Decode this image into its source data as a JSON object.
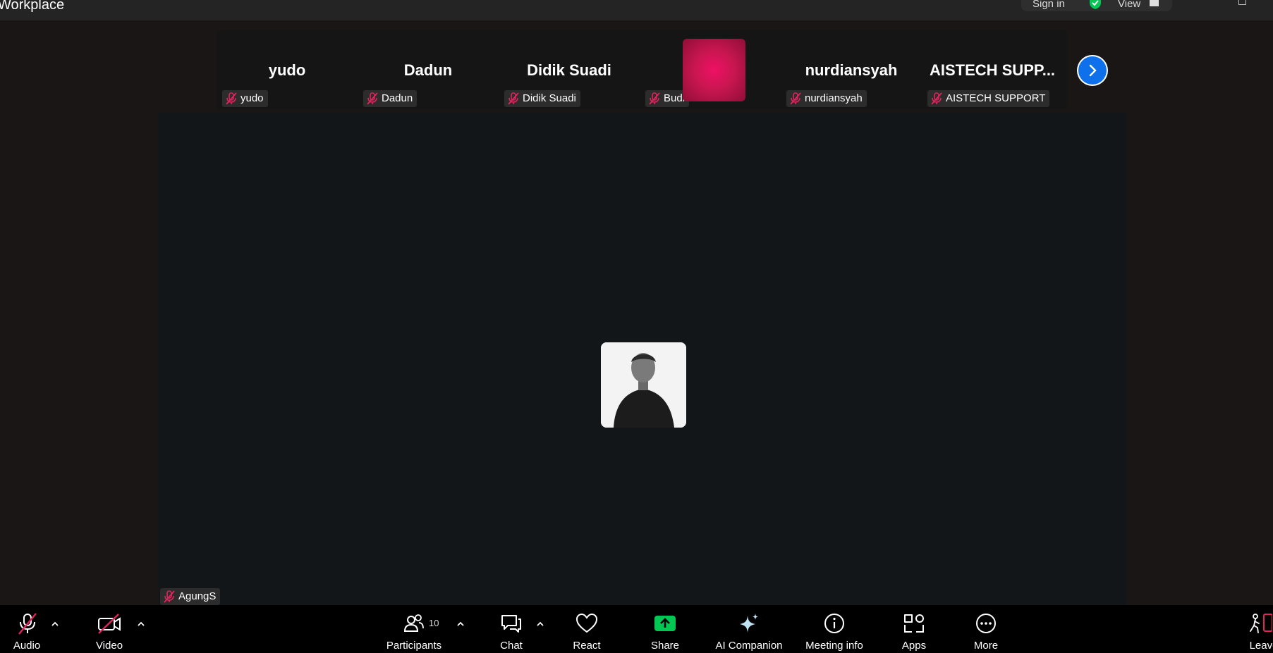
{
  "window": {
    "title": "Workplace",
    "sign_in": "Sign in",
    "view": "View"
  },
  "strip": {
    "tiles": [
      {
        "big": "yudo",
        "tag": "yudo"
      },
      {
        "big": "Dadun",
        "tag": "Dadun"
      },
      {
        "big": "Didik Suadi",
        "tag": "Didik Suadi"
      },
      {
        "big": "",
        "tag": "Budi"
      },
      {
        "big": "nurdiansyah",
        "tag": "nurdiansyah"
      },
      {
        "big": "AISTECH SUPP...",
        "tag": "AISTECH SUPPORT"
      }
    ]
  },
  "active_speaker": {
    "name": "AgungS"
  },
  "toolbar": {
    "audio": "Audio",
    "video": "Video",
    "participants": "Participants",
    "participants_count": "10",
    "chat": "Chat",
    "react": "React",
    "share": "Share",
    "ai_companion": "AI Companion",
    "meeting_info": "Meeting info",
    "apps": "Apps",
    "more": "More",
    "leave": "Leave"
  },
  "colors": {
    "accent_blue": "#0e71eb",
    "share_green": "#00c853",
    "muted_red": "#e0245e",
    "budi_avatar": "#d4145a"
  }
}
